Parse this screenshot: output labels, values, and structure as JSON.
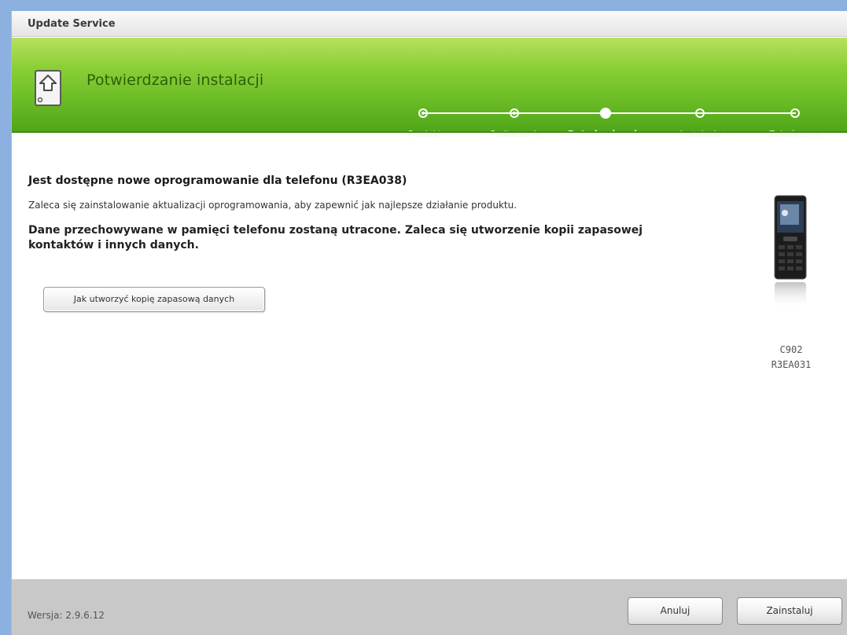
{
  "window": {
    "title": "Update Service"
  },
  "header": {
    "title": "Potwierdzanie instalacji",
    "steps": [
      {
        "label": "Produkt",
        "state": "done"
      },
      {
        "label": "Podłączanie",
        "state": "done"
      },
      {
        "label": "Potwierdzanie",
        "state": "current"
      },
      {
        "label": "Instalacja",
        "state": "pending"
      },
      {
        "label": "Zakończono",
        "state": "pending"
      }
    ]
  },
  "content": {
    "heading": "Jest dostępne nowe oprogramowanie dla telefonu (R3EA038)",
    "note": "Zaleca się zainstalowanie aktualizacji oprogramowania, aby zapewnić jak najlepsze działanie produktu.",
    "warning": "Dane przechowywane w pamięci telefonu zostaną utracone. Zaleca się utworzenie kopii zapasowej kontaktów i innych danych.",
    "backup_button": "Jak utworzyć kopię zapasową danych",
    "phone": {
      "model": "C902",
      "firmware": "R3EA031"
    }
  },
  "footer": {
    "version": "Wersja: 2.9.6.12",
    "cancel_label": "Anuluj",
    "install_label": "Zainstaluj"
  },
  "colors": {
    "header_green_light": "#b8e060",
    "header_green_dark": "#4ea418",
    "title_green": "#2f5e08",
    "footer_gray": "#c8c8c8"
  },
  "icons": {
    "header": "phone-update-icon",
    "step_done": "step-done-icon",
    "step_current": "step-current-icon",
    "step_pending": "step-pending-icon"
  }
}
